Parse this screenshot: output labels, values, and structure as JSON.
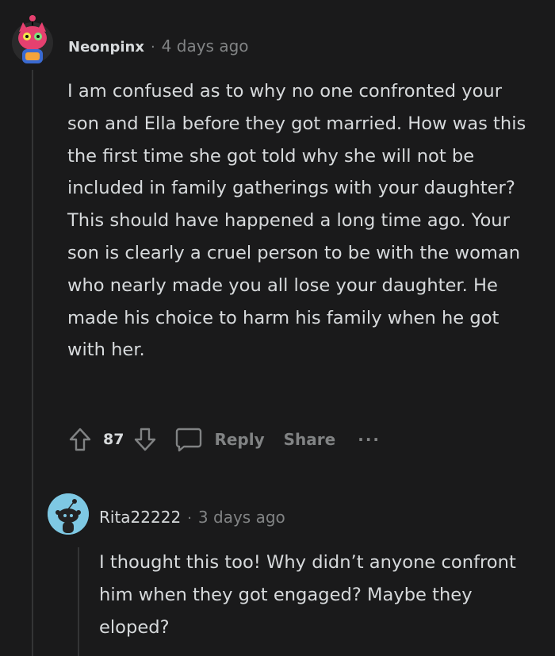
{
  "comments": [
    {
      "username": "Neonpinx",
      "separator": "·",
      "time": "4 days ago",
      "body": "I am confused as to why no one confronted your son and Ella before they got married. How was this the first time she got told why she will not be included in family gatherings with your daughter? This should have happened a long time ago. Your son is clearly a cruel person to be with the woman who nearly made you all lose your daughter. He made his choice to harm his family when he got with her.",
      "actions": {
        "upvote_icon": "upvote-arrow-icon",
        "score": "87",
        "downvote_icon": "downvote-arrow-icon",
        "comment_icon": "comment-bubble-icon",
        "reply_label": "Reply",
        "share_label": "Share",
        "more_label": "···"
      }
    },
    {
      "username": "Rita22222",
      "separator": "·",
      "time": "3 days ago",
      "body": "I thought this too! Why didn’t anyone confront him when they got engaged? Maybe they eloped?"
    }
  ],
  "colors": {
    "background": "#1a1a1b",
    "text": "#d7dadc",
    "muted": "#818384",
    "thread_line": "#343536",
    "avatar_pink": "#e5406f",
    "avatar_blue": "#7ec8e3"
  }
}
